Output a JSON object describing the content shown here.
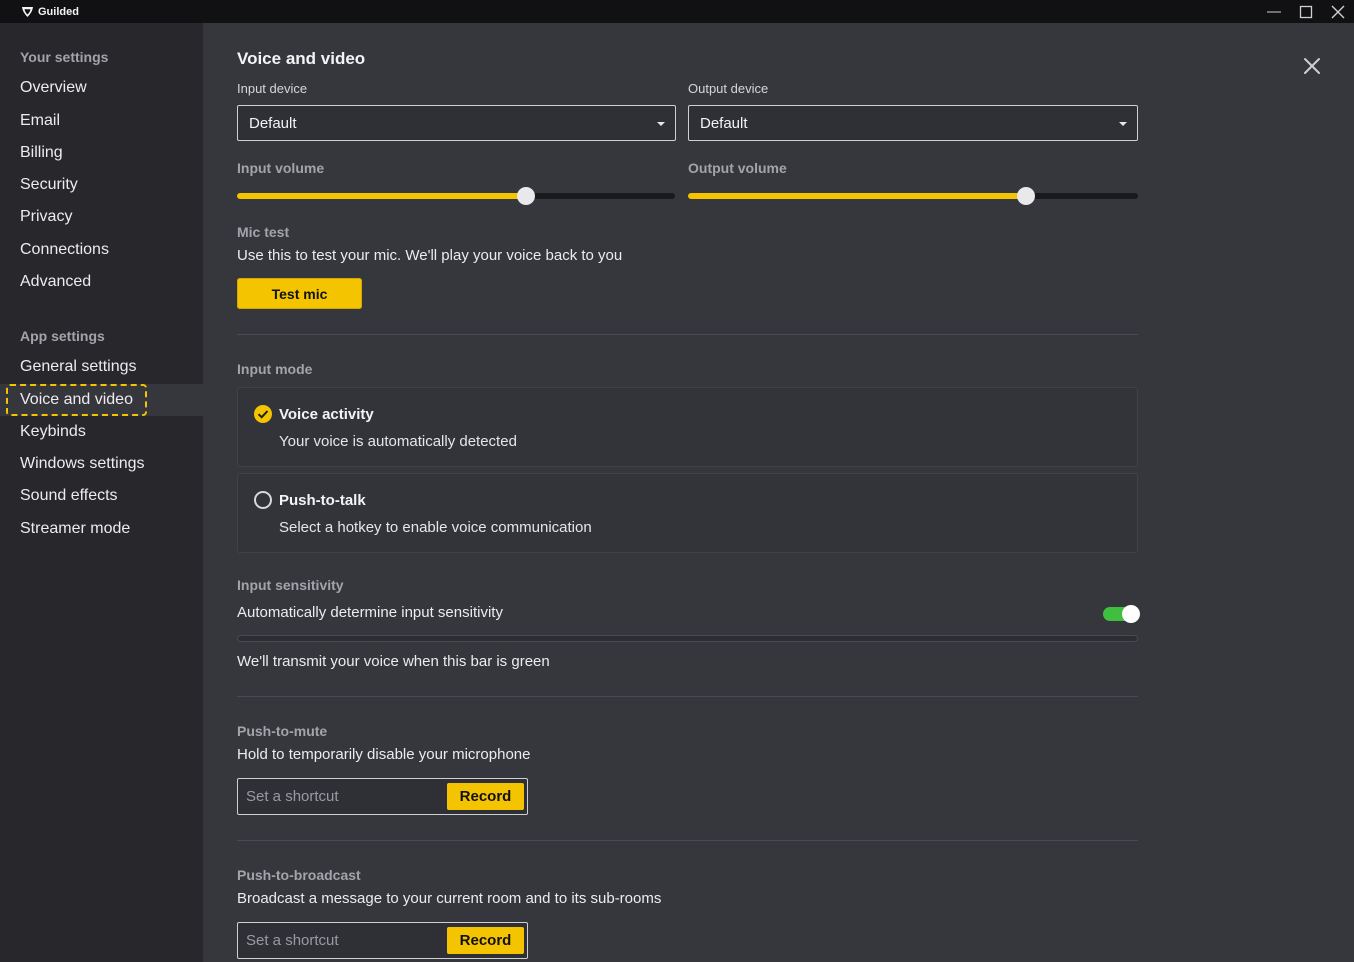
{
  "app": {
    "name": "Guilded"
  },
  "sidebar": {
    "your_settings_heading": "Your settings",
    "your_settings": [
      "Overview",
      "Email",
      "Billing",
      "Security",
      "Privacy",
      "Connections",
      "Advanced"
    ],
    "app_settings_heading": "App settings",
    "app_settings": [
      "General settings",
      "Voice and video",
      "Keybinds",
      "Windows settings",
      "Sound effects",
      "Streamer mode"
    ],
    "active_item": "Voice and video"
  },
  "page": {
    "title": "Voice and video",
    "input_device": {
      "label": "Input device",
      "value": "Default"
    },
    "output_device": {
      "label": "Output device",
      "value": "Default"
    },
    "input_volume": {
      "label": "Input volume",
      "level": 0.66
    },
    "output_volume": {
      "label": "Output volume",
      "level": 0.75
    },
    "mic_test": {
      "heading": "Mic test",
      "description": "Use this to test your mic. We'll play your voice back to you",
      "button": "Test mic"
    },
    "input_mode": {
      "heading": "Input mode",
      "options": [
        {
          "title": "Voice activity",
          "description": "Your voice is automatically detected",
          "selected": true
        },
        {
          "title": "Push-to-talk",
          "description": "Select a hotkey to enable voice communication",
          "selected": false
        }
      ]
    },
    "input_sensitivity": {
      "heading": "Input sensitivity",
      "auto_label": "Automatically determine input sensitivity",
      "auto_enabled": true,
      "hint": "We'll transmit your voice when this bar is green"
    },
    "push_to_mute": {
      "heading": "Push-to-mute",
      "description": "Hold to temporarily disable your microphone",
      "placeholder": "Set a shortcut",
      "record": "Record"
    },
    "push_to_broadcast": {
      "heading": "Push-to-broadcast",
      "description": "Broadcast a message to your current room and to its sub-rooms",
      "placeholder": "Set a shortcut",
      "record": "Record"
    }
  },
  "colors": {
    "accent": "#f5c400",
    "toggle_on": "#3fbf3f",
    "sidebar_bg": "#27272c",
    "main_bg": "#36363d"
  }
}
